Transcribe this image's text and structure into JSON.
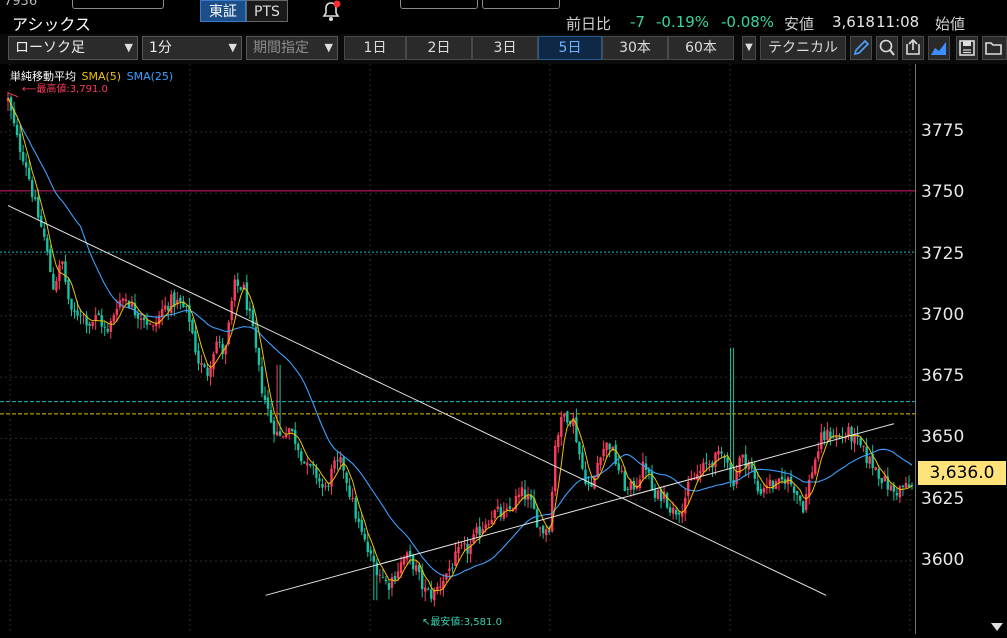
{
  "header": {
    "stock_name": "アシックス",
    "exchange_tabs": [
      {
        "label": "東証",
        "active": true
      },
      {
        "label": "PTS",
        "active": false
      }
    ],
    "quote": {
      "change_label": "前日比",
      "change_value": "-7",
      "change_pct": "-0.19%",
      "change_pct2": "-0.08%",
      "low_label": "安値",
      "low_value": "3,618",
      "low_time": "11:08",
      "open_label": "始値"
    }
  },
  "toolbar": {
    "chart_type": "ローソク足",
    "interval": "1分",
    "period_placeholder": "期間指定",
    "ranges": [
      {
        "label": "1日",
        "active": false
      },
      {
        "label": "2日",
        "active": false
      },
      {
        "label": "3日",
        "active": false
      },
      {
        "label": "5日",
        "active": true
      },
      {
        "label": "30本",
        "active": false
      },
      {
        "label": "60本",
        "active": false
      }
    ],
    "technical_label": "テクニカル",
    "icons": [
      "pencil-icon",
      "zoom-icon",
      "export-icon",
      "area-chart-icon",
      "save-icon",
      "folder-icon"
    ]
  },
  "colors": {
    "up": "#ff3b5c",
    "down": "#17c3a0",
    "sma5": "#f0c000",
    "sma25": "#3da0ff",
    "price_box": "#ffe27a",
    "high_line": "#d01c6a",
    "cyan_line": "#22b8c8",
    "yellow_line": "#e0c400"
  },
  "chart": {
    "legend": {
      "title": "単純移動平均",
      "sma5": "SMA(5)",
      "sma25": "SMA(25)"
    },
    "high_label": "最高値:3,791.0",
    "low_label": "最安値:3,581.0",
    "current_price": "3,636.0"
  },
  "chart_data": {
    "type": "candlestick",
    "y_ticks": [
      "3775",
      "3750",
      "3725",
      "3700",
      "3675",
      "3650",
      "3625",
      "3600"
    ],
    "ylim": [
      3575,
      3795
    ],
    "high": 3791.0,
    "low": 3581.0,
    "current": 3636.0,
    "horizontal_lines": [
      {
        "price": 3751,
        "style": "solid",
        "color": "#d01c6a"
      },
      {
        "price": 3726,
        "style": "dotted",
        "color": "#22b8c8"
      },
      {
        "price": 3665,
        "style": "dashed",
        "color": "#22b8c8"
      },
      {
        "price": 3660,
        "style": "dashed",
        "color": "#e0c400"
      }
    ],
    "trend_lines": [
      {
        "from": [
          0.0,
          3745
        ],
        "to": [
          0.905,
          3586
        ]
      },
      {
        "from": [
          0.285,
          3586
        ],
        "to": [
          0.98,
          3656
        ]
      }
    ],
    "price_path": [
      [
        0.0,
        3788
      ],
      [
        0.01,
        3772
      ],
      [
        0.02,
        3762
      ],
      [
        0.03,
        3745
      ],
      [
        0.04,
        3732
      ],
      [
        0.05,
        3712
      ],
      [
        0.06,
        3722
      ],
      [
        0.07,
        3700
      ],
      [
        0.08,
        3702
      ],
      [
        0.09,
        3697
      ],
      [
        0.1,
        3700
      ],
      [
        0.11,
        3692
      ],
      [
        0.12,
        3705
      ],
      [
        0.13,
        3708
      ],
      [
        0.14,
        3702
      ],
      [
        0.15,
        3700
      ],
      [
        0.16,
        3694
      ],
      [
        0.17,
        3702
      ],
      [
        0.18,
        3706
      ],
      [
        0.19,
        3705
      ],
      [
        0.2,
        3700
      ],
      [
        0.21,
        3682
      ],
      [
        0.22,
        3676
      ],
      [
        0.23,
        3690
      ],
      [
        0.24,
        3684
      ],
      [
        0.25,
        3712
      ],
      [
        0.26,
        3712
      ],
      [
        0.27,
        3695
      ],
      [
        0.28,
        3672
      ],
      [
        0.29,
        3658
      ],
      [
        0.3,
        3650
      ],
      [
        0.31,
        3655
      ],
      [
        0.32,
        3648
      ],
      [
        0.33,
        3638
      ],
      [
        0.34,
        3636
      ],
      [
        0.35,
        3628
      ],
      [
        0.36,
        3638
      ],
      [
        0.37,
        3640
      ],
      [
        0.38,
        3625
      ],
      [
        0.39,
        3612
      ],
      [
        0.4,
        3602
      ],
      [
        0.41,
        3596
      ],
      [
        0.42,
        3590
      ],
      [
        0.43,
        3596
      ],
      [
        0.44,
        3602
      ],
      [
        0.45,
        3598
      ],
      [
        0.46,
        3588
      ],
      [
        0.47,
        3586
      ],
      [
        0.48,
        3592
      ],
      [
        0.49,
        3598
      ],
      [
        0.5,
        3604
      ],
      [
        0.51,
        3605
      ],
      [
        0.52,
        3612
      ],
      [
        0.53,
        3617
      ],
      [
        0.54,
        3620
      ],
      [
        0.55,
        3618
      ],
      [
        0.56,
        3624
      ],
      [
        0.57,
        3628
      ],
      [
        0.58,
        3622
      ],
      [
        0.59,
        3612
      ],
      [
        0.6,
        3615
      ],
      [
        0.605,
        3648
      ],
      [
        0.615,
        3660
      ],
      [
        0.625,
        3658
      ],
      [
        0.635,
        3638
      ],
      [
        0.645,
        3628
      ],
      [
        0.655,
        3645
      ],
      [
        0.665,
        3648
      ],
      [
        0.675,
        3638
      ],
      [
        0.685,
        3628
      ],
      [
        0.695,
        3632
      ],
      [
        0.705,
        3640
      ],
      [
        0.715,
        3625
      ],
      [
        0.725,
        3628
      ],
      [
        0.735,
        3620
      ],
      [
        0.745,
        3622
      ],
      [
        0.755,
        3632
      ],
      [
        0.765,
        3636
      ],
      [
        0.775,
        3640
      ],
      [
        0.785,
        3642
      ],
      [
        0.795,
        3645
      ],
      [
        0.8,
        3630
      ],
      [
        0.81,
        3642
      ],
      [
        0.82,
        3640
      ],
      [
        0.83,
        3628
      ],
      [
        0.84,
        3632
      ],
      [
        0.85,
        3630
      ],
      [
        0.86,
        3634
      ],
      [
        0.87,
        3630
      ],
      [
        0.88,
        3622
      ],
      [
        0.89,
        3638
      ],
      [
        0.9,
        3650
      ],
      [
        0.91,
        3652
      ],
      [
        0.92,
        3650
      ],
      [
        0.93,
        3652
      ],
      [
        0.94,
        3648
      ],
      [
        0.95,
        3642
      ],
      [
        0.96,
        3638
      ],
      [
        0.97,
        3632
      ],
      [
        0.98,
        3628
      ],
      [
        0.99,
        3630
      ],
      [
        1.0,
        3630
      ]
    ],
    "spikes": [
      {
        "at": 0.8,
        "high": 3687
      },
      {
        "at": 0.3,
        "high": 3680
      },
      {
        "at": 0.405,
        "low": 3584
      }
    ]
  }
}
